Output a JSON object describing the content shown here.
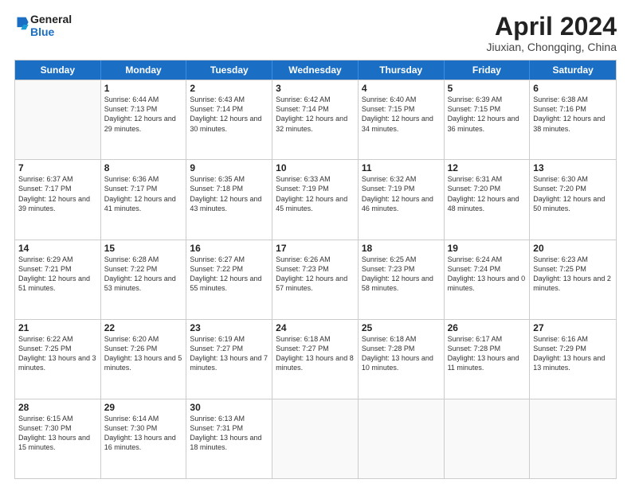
{
  "logo": {
    "line1": "General",
    "line2": "Blue"
  },
  "title": "April 2024",
  "subtitle": "Jiuxian, Chongqing, China",
  "days": [
    "Sunday",
    "Monday",
    "Tuesday",
    "Wednesday",
    "Thursday",
    "Friday",
    "Saturday"
  ],
  "weeks": [
    [
      {
        "day": "",
        "sunrise": "",
        "sunset": "",
        "daylight": ""
      },
      {
        "day": "1",
        "sunrise": "Sunrise: 6:44 AM",
        "sunset": "Sunset: 7:13 PM",
        "daylight": "Daylight: 12 hours and 29 minutes."
      },
      {
        "day": "2",
        "sunrise": "Sunrise: 6:43 AM",
        "sunset": "Sunset: 7:14 PM",
        "daylight": "Daylight: 12 hours and 30 minutes."
      },
      {
        "day": "3",
        "sunrise": "Sunrise: 6:42 AM",
        "sunset": "Sunset: 7:14 PM",
        "daylight": "Daylight: 12 hours and 32 minutes."
      },
      {
        "day": "4",
        "sunrise": "Sunrise: 6:40 AM",
        "sunset": "Sunset: 7:15 PM",
        "daylight": "Daylight: 12 hours and 34 minutes."
      },
      {
        "day": "5",
        "sunrise": "Sunrise: 6:39 AM",
        "sunset": "Sunset: 7:15 PM",
        "daylight": "Daylight: 12 hours and 36 minutes."
      },
      {
        "day": "6",
        "sunrise": "Sunrise: 6:38 AM",
        "sunset": "Sunset: 7:16 PM",
        "daylight": "Daylight: 12 hours and 38 minutes."
      }
    ],
    [
      {
        "day": "7",
        "sunrise": "Sunrise: 6:37 AM",
        "sunset": "Sunset: 7:17 PM",
        "daylight": "Daylight: 12 hours and 39 minutes."
      },
      {
        "day": "8",
        "sunrise": "Sunrise: 6:36 AM",
        "sunset": "Sunset: 7:17 PM",
        "daylight": "Daylight: 12 hours and 41 minutes."
      },
      {
        "day": "9",
        "sunrise": "Sunrise: 6:35 AM",
        "sunset": "Sunset: 7:18 PM",
        "daylight": "Daylight: 12 hours and 43 minutes."
      },
      {
        "day": "10",
        "sunrise": "Sunrise: 6:33 AM",
        "sunset": "Sunset: 7:19 PM",
        "daylight": "Daylight: 12 hours and 45 minutes."
      },
      {
        "day": "11",
        "sunrise": "Sunrise: 6:32 AM",
        "sunset": "Sunset: 7:19 PM",
        "daylight": "Daylight: 12 hours and 46 minutes."
      },
      {
        "day": "12",
        "sunrise": "Sunrise: 6:31 AM",
        "sunset": "Sunset: 7:20 PM",
        "daylight": "Daylight: 12 hours and 48 minutes."
      },
      {
        "day": "13",
        "sunrise": "Sunrise: 6:30 AM",
        "sunset": "Sunset: 7:20 PM",
        "daylight": "Daylight: 12 hours and 50 minutes."
      }
    ],
    [
      {
        "day": "14",
        "sunrise": "Sunrise: 6:29 AM",
        "sunset": "Sunset: 7:21 PM",
        "daylight": "Daylight: 12 hours and 51 minutes."
      },
      {
        "day": "15",
        "sunrise": "Sunrise: 6:28 AM",
        "sunset": "Sunset: 7:22 PM",
        "daylight": "Daylight: 12 hours and 53 minutes."
      },
      {
        "day": "16",
        "sunrise": "Sunrise: 6:27 AM",
        "sunset": "Sunset: 7:22 PM",
        "daylight": "Daylight: 12 hours and 55 minutes."
      },
      {
        "day": "17",
        "sunrise": "Sunrise: 6:26 AM",
        "sunset": "Sunset: 7:23 PM",
        "daylight": "Daylight: 12 hours and 57 minutes."
      },
      {
        "day": "18",
        "sunrise": "Sunrise: 6:25 AM",
        "sunset": "Sunset: 7:23 PM",
        "daylight": "Daylight: 12 hours and 58 minutes."
      },
      {
        "day": "19",
        "sunrise": "Sunrise: 6:24 AM",
        "sunset": "Sunset: 7:24 PM",
        "daylight": "Daylight: 13 hours and 0 minutes."
      },
      {
        "day": "20",
        "sunrise": "Sunrise: 6:23 AM",
        "sunset": "Sunset: 7:25 PM",
        "daylight": "Daylight: 13 hours and 2 minutes."
      }
    ],
    [
      {
        "day": "21",
        "sunrise": "Sunrise: 6:22 AM",
        "sunset": "Sunset: 7:25 PM",
        "daylight": "Daylight: 13 hours and 3 minutes."
      },
      {
        "day": "22",
        "sunrise": "Sunrise: 6:20 AM",
        "sunset": "Sunset: 7:26 PM",
        "daylight": "Daylight: 13 hours and 5 minutes."
      },
      {
        "day": "23",
        "sunrise": "Sunrise: 6:19 AM",
        "sunset": "Sunset: 7:27 PM",
        "daylight": "Daylight: 13 hours and 7 minutes."
      },
      {
        "day": "24",
        "sunrise": "Sunrise: 6:18 AM",
        "sunset": "Sunset: 7:27 PM",
        "daylight": "Daylight: 13 hours and 8 minutes."
      },
      {
        "day": "25",
        "sunrise": "Sunrise: 6:18 AM",
        "sunset": "Sunset: 7:28 PM",
        "daylight": "Daylight: 13 hours and 10 minutes."
      },
      {
        "day": "26",
        "sunrise": "Sunrise: 6:17 AM",
        "sunset": "Sunset: 7:28 PM",
        "daylight": "Daylight: 13 hours and 11 minutes."
      },
      {
        "day": "27",
        "sunrise": "Sunrise: 6:16 AM",
        "sunset": "Sunset: 7:29 PM",
        "daylight": "Daylight: 13 hours and 13 minutes."
      }
    ],
    [
      {
        "day": "28",
        "sunrise": "Sunrise: 6:15 AM",
        "sunset": "Sunset: 7:30 PM",
        "daylight": "Daylight: 13 hours and 15 minutes."
      },
      {
        "day": "29",
        "sunrise": "Sunrise: 6:14 AM",
        "sunset": "Sunset: 7:30 PM",
        "daylight": "Daylight: 13 hours and 16 minutes."
      },
      {
        "day": "30",
        "sunrise": "Sunrise: 6:13 AM",
        "sunset": "Sunset: 7:31 PM",
        "daylight": "Daylight: 13 hours and 18 minutes."
      },
      {
        "day": "",
        "sunrise": "",
        "sunset": "",
        "daylight": ""
      },
      {
        "day": "",
        "sunrise": "",
        "sunset": "",
        "daylight": ""
      },
      {
        "day": "",
        "sunrise": "",
        "sunset": "",
        "daylight": ""
      },
      {
        "day": "",
        "sunrise": "",
        "sunset": "",
        "daylight": ""
      }
    ]
  ]
}
